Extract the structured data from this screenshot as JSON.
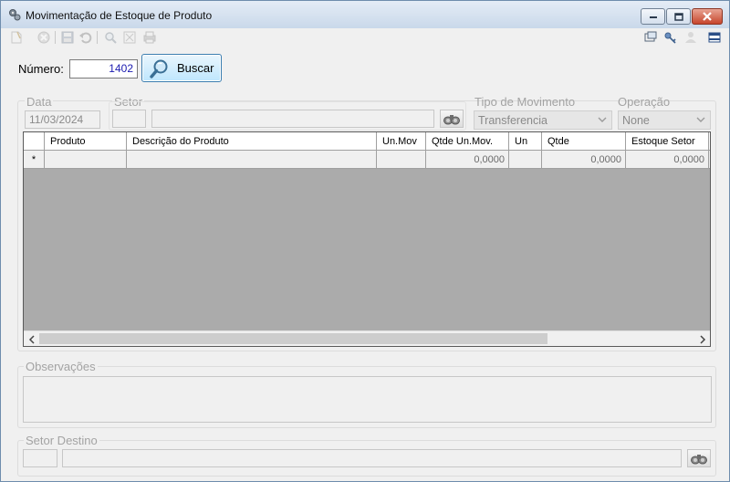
{
  "window": {
    "title": "Movimentação de Estoque de Produto"
  },
  "toolbar": {
    "left_tools": [
      "new-icon",
      "cancel-icon",
      "save-icon",
      "undo-icon",
      "search-icon",
      "expand-icon",
      "print-icon"
    ],
    "right_tools": [
      "window-icon",
      "key-icon",
      "user-icon",
      "panel-icon"
    ]
  },
  "search": {
    "numero_label": "Número:",
    "numero_value": "1402",
    "button_label": "Buscar"
  },
  "header": {
    "data_label": "Data",
    "data_value": "11/03/2024",
    "setor_label": "Setor",
    "setor_code": "",
    "setor_name": "",
    "tipo_label": "Tipo de Movimento",
    "tipo_value": "Transferencia",
    "operacao_label": "Operação",
    "operacao_value": "None"
  },
  "grid": {
    "columns": [
      "Produto",
      "Descrição do Produto",
      "Un.Mov",
      "Qtde Un.Mov.",
      "Un",
      "Qtde",
      "Estoque Setor"
    ],
    "new_row_marker": "*",
    "rows": [
      [
        "",
        "",
        "",
        "0,0000",
        "",
        "0,0000",
        "0,0000"
      ]
    ]
  },
  "observacoes": {
    "label": "Observações",
    "value": ""
  },
  "setor_destino": {
    "label": "Setor Destino",
    "code": "",
    "name": ""
  },
  "colors": {
    "accent": "#3c7fb1",
    "number_text": "#1a1ab0",
    "disabled_text": "#a3a3a3",
    "grid_empty": "#ababab"
  }
}
